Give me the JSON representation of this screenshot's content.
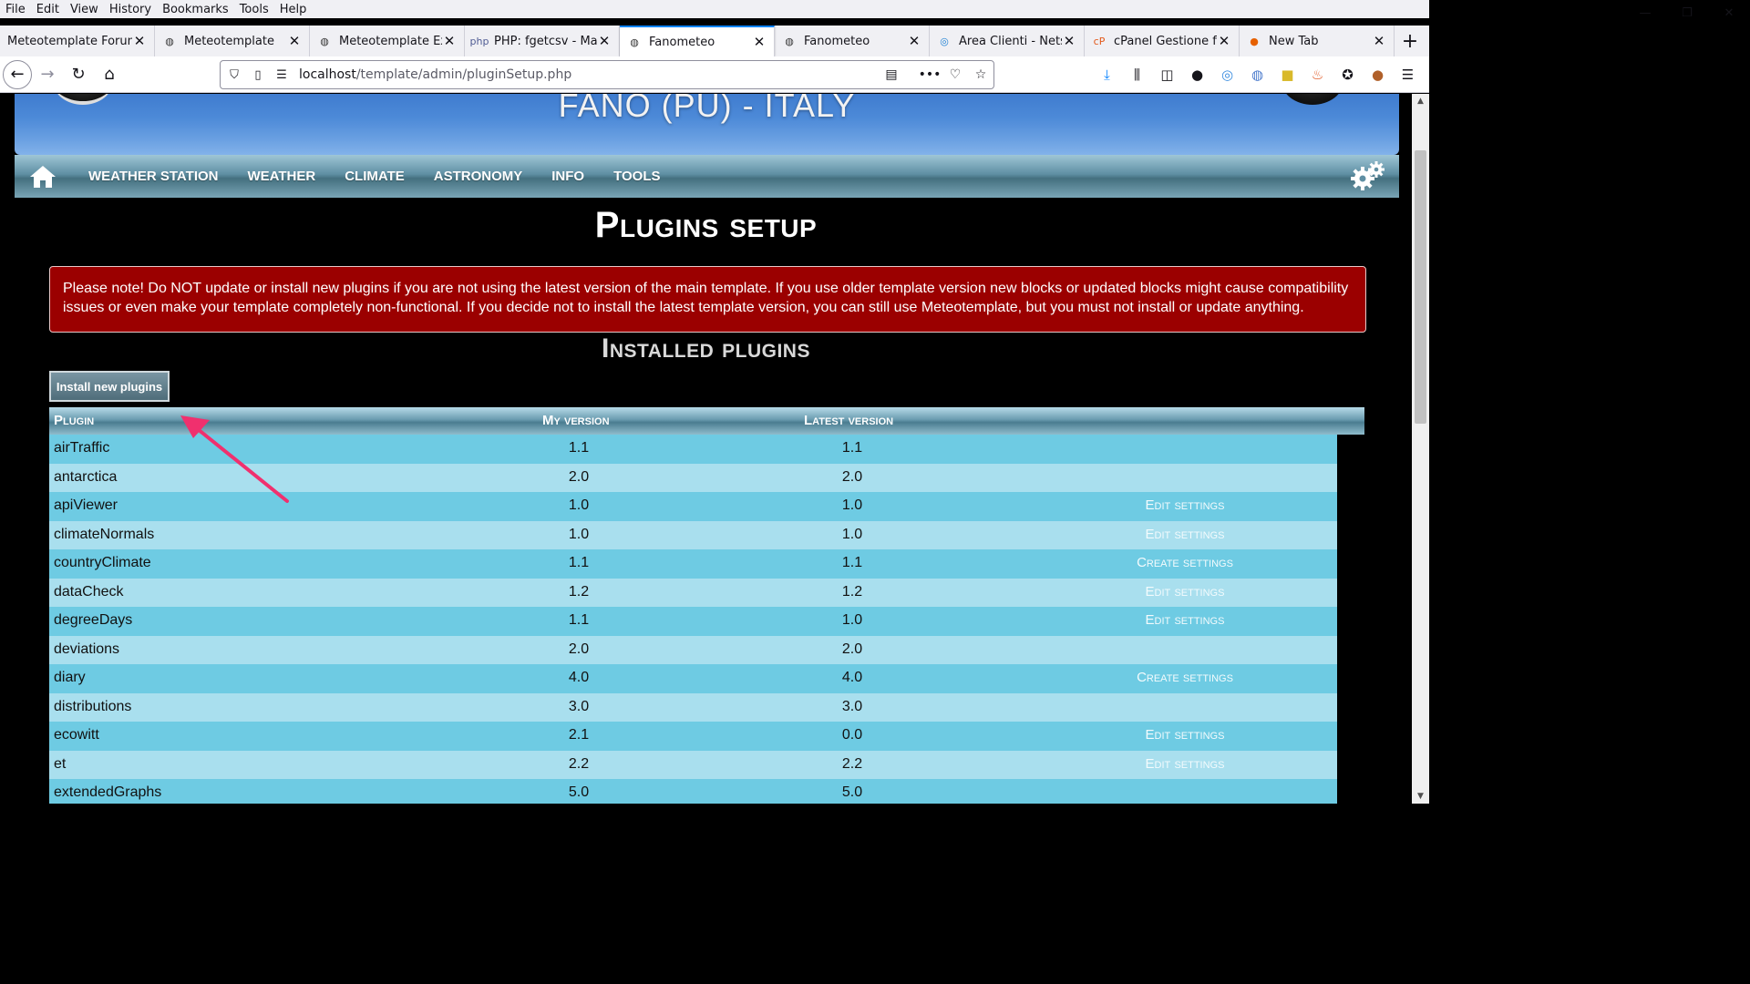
{
  "menu": [
    "File",
    "Edit",
    "View",
    "History",
    "Bookmarks",
    "Tools",
    "Help"
  ],
  "window_controls": {
    "minimize": "—",
    "restore": "❐",
    "close": "✕"
  },
  "tabs": [
    {
      "title": "Meteotemplate Forum - ",
      "icon": "globe-icon",
      "active": false
    },
    {
      "title": "Meteotemplate",
      "icon": "globe-icon",
      "active": false
    },
    {
      "title": "Meteotemplate Extr",
      "icon": "globe-icon",
      "active": false
    },
    {
      "title": "PHP: fgetcsv - Manu",
      "icon": "php-icon",
      "active": false
    },
    {
      "title": "Fanometeo",
      "icon": "globe-icon",
      "active": true
    },
    {
      "title": "Fanometeo",
      "icon": "globe-icon",
      "active": false
    },
    {
      "title": "Area Clienti - Netso",
      "icon": "netsons-icon",
      "active": false
    },
    {
      "title": "cPanel Gestione file",
      "icon": "cpanel-icon",
      "active": false
    },
    {
      "title": "New Tab",
      "icon": "firefox-icon",
      "active": false
    }
  ],
  "url": {
    "host": "localhost",
    "path": "/template/admin/pluginSetup.php"
  },
  "header": {
    "location": "FANO (PU) - ITALY"
  },
  "nav": [
    "WEATHER STATION",
    "WEATHER",
    "CLIMATE",
    "ASTRONOMY",
    "INFO",
    "TOOLS"
  ],
  "page_title": "Plugins setup",
  "warning": "Please note! Do NOT update or install new plugins if you are not using the latest version of the main template. If you use older template version new blocks or updated blocks might cause compatibility issues or even make your template completely non-functional. If you decide not to install the latest template version, you can still use Meteotemplate, but you must not install or update anything.",
  "installed_title": "Installed plugins",
  "install_button": "Install new plugins",
  "table": {
    "headers": {
      "plugin": "Plugin",
      "my_version": "My version",
      "latest_version": "Latest version"
    },
    "rows": [
      {
        "name": "airTraffic",
        "mine": "1.1",
        "latest": "1.1",
        "action": ""
      },
      {
        "name": "antarctica",
        "mine": "2.0",
        "latest": "2.0",
        "action": ""
      },
      {
        "name": "apiViewer",
        "mine": "1.0",
        "latest": "1.0",
        "action": "Edit settings"
      },
      {
        "name": "climateNormals",
        "mine": "1.0",
        "latest": "1.0",
        "action": "Edit settings"
      },
      {
        "name": "countryClimate",
        "mine": "1.1",
        "latest": "1.1",
        "action": "Create settings"
      },
      {
        "name": "dataCheck",
        "mine": "1.2",
        "latest": "1.2",
        "action": "Edit settings"
      },
      {
        "name": "degreeDays",
        "mine": "1.1",
        "latest": "1.0",
        "action": "Edit settings"
      },
      {
        "name": "deviations",
        "mine": "2.0",
        "latest": "2.0",
        "action": ""
      },
      {
        "name": "diary",
        "mine": "4.0",
        "latest": "4.0",
        "action": "Create settings"
      },
      {
        "name": "distributions",
        "mine": "3.0",
        "latest": "3.0",
        "action": ""
      },
      {
        "name": "ecowitt",
        "mine": "2.1",
        "latest": "0.0",
        "action": "Edit settings"
      },
      {
        "name": "et",
        "mine": "2.2",
        "latest": "2.2",
        "action": "Edit settings"
      },
      {
        "name": "extendedGraphs",
        "mine": "5.0",
        "latest": "5.0",
        "action": ""
      }
    ]
  },
  "colors": {
    "warning_bg": "#9b0000",
    "row_odd": "#6ecbe3",
    "row_even": "#a9dfee",
    "annotation_arrow": "#f0306e"
  }
}
